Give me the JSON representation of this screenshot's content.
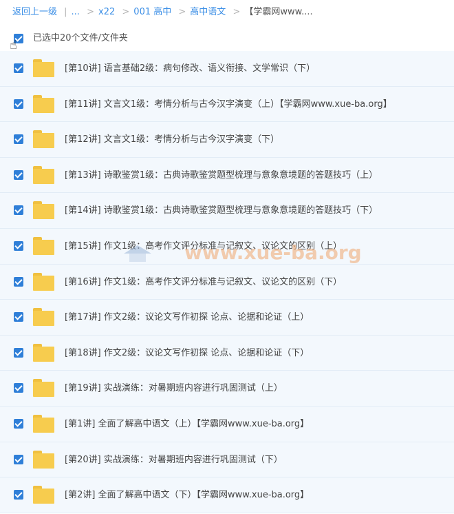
{
  "breadcrumb": {
    "back": "返回上一级",
    "ellipsis": "...",
    "items": [
      "x22",
      "001 高中",
      "高中语文"
    ],
    "current": "【学霸网www...."
  },
  "selection": {
    "text": "已选中20个文件/文件夹"
  },
  "files": [
    {
      "name": "[第10讲] 语言基础2级：病句修改、语义衔接、文学常识（下）"
    },
    {
      "name": "[第11讲] 文言文1级：考情分析与古今汉字演变（上）【学霸网www.xue-ba.org】"
    },
    {
      "name": "[第12讲] 文言文1级：考情分析与古今汉字演变（下）"
    },
    {
      "name": "[第13讲] 诗歌鉴赏1级：古典诗歌鉴赏题型梳理与意象意境题的答题技巧（上）"
    },
    {
      "name": "[第14讲] 诗歌鉴赏1级：古典诗歌鉴赏题型梳理与意象意境题的答题技巧（下）"
    },
    {
      "name": "[第15讲] 作文1级：高考作文评分标准与记叙文、议论文的区别（上）"
    },
    {
      "name": "[第16讲] 作文1级：高考作文评分标准与记叙文、议论文的区别（下）"
    },
    {
      "name": "[第17讲] 作文2级：议论文写作初探 论点、论据和论证（上）"
    },
    {
      "name": "[第18讲] 作文2级：议论文写作初探 论点、论据和论证（下）"
    },
    {
      "name": "[第19讲] 实战演练：对暑期班内容进行巩固测试（上）"
    },
    {
      "name": "[第1讲] 全面了解高中语文（上）【学霸网www.xue-ba.org】"
    },
    {
      "name": "[第20讲] 实战演练：对暑期班内容进行巩固测试（下）"
    },
    {
      "name": "[第2讲] 全面了解高中语文（下）【学霸网www.xue-ba.org】"
    }
  ],
  "watermark": "www.xue-ba.org",
  "colors": {
    "link": "#3a8ee6",
    "checkbox": "#2f7fd8",
    "folder": "#f7cc4e",
    "row_bg": "#f3f8fd"
  }
}
